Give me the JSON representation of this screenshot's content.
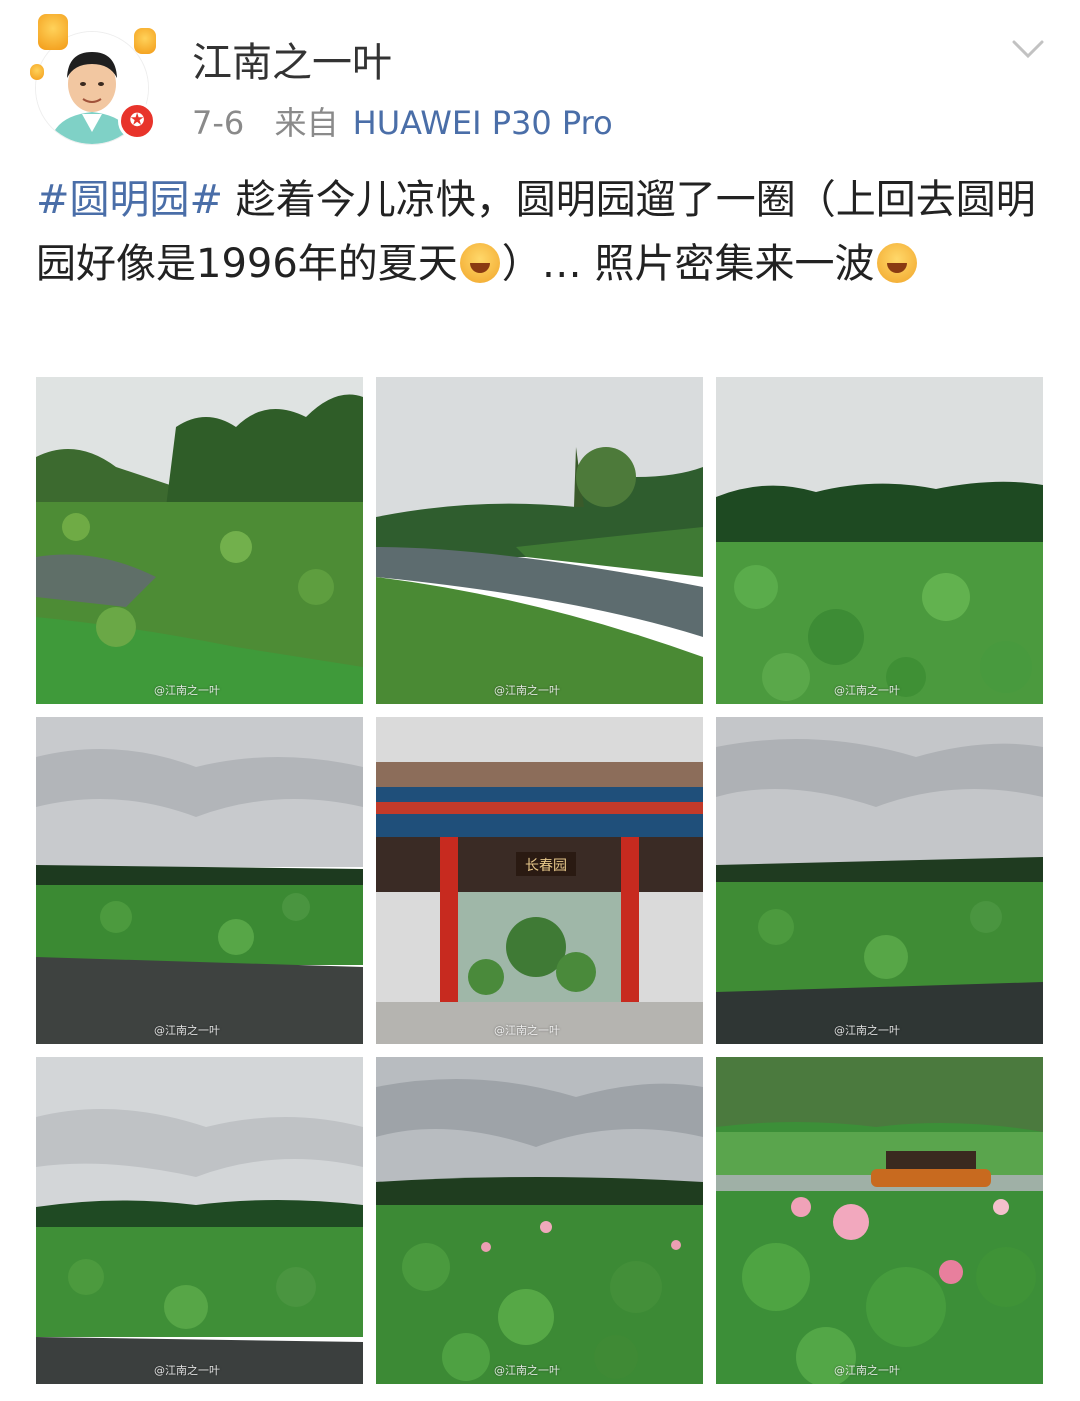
{
  "post": {
    "author": "江南之一叶",
    "date": "7-6",
    "from_label": "来自",
    "device": "HUAWEI P30 Pro",
    "hashtag": "#圆明园#",
    "text_1": " 趁着今儿凉快，圆明园遛了一圈（上回去圆明园好像是1996年的夏天",
    "text_2": "）… 照片密集来一波",
    "emoji_1": "laughing-tears-emoji",
    "emoji_2": "laughing-emoji",
    "verified_badge_color": "#e8342b",
    "link_color": "#4a6ea8"
  },
  "photos": [
    {
      "watermark": "@江南之一叶",
      "scene": "lotus-pond-trees"
    },
    {
      "watermark": "@江南之一叶",
      "scene": "stream-reeds"
    },
    {
      "watermark": "@江南之一叶",
      "scene": "lotus-field"
    },
    {
      "watermark": "@江南之一叶",
      "scene": "overcast-lotus-water"
    },
    {
      "watermark": "@江南之一叶",
      "scene": "gate-building",
      "gate_sign": "长春园"
    },
    {
      "watermark": "@江南之一叶",
      "scene": "overcast-lotus-field"
    },
    {
      "watermark": "@江南之一叶",
      "scene": "overcast-lotus-lake"
    },
    {
      "watermark": "@江南之一叶",
      "scene": "lotus-flowers"
    },
    {
      "watermark": "@江南之一叶",
      "scene": "lotus-boat"
    }
  ]
}
